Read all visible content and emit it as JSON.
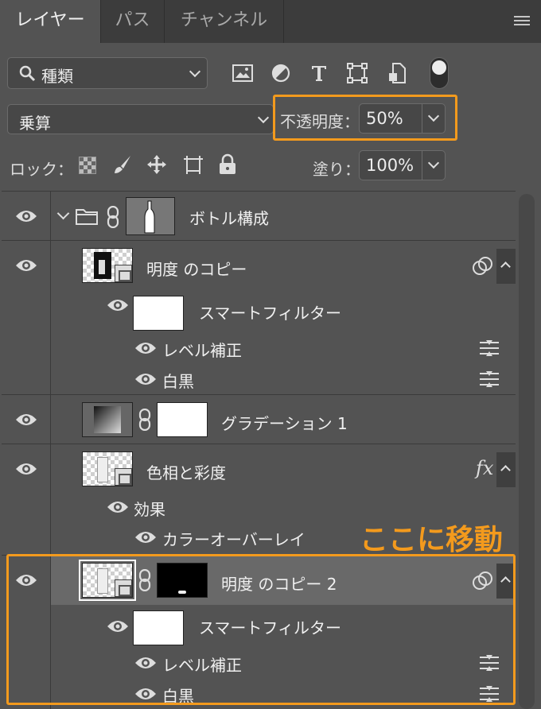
{
  "tabs": [
    "レイヤー",
    "パス",
    "チャンネル"
  ],
  "filter": {
    "kind_label": "種類"
  },
  "blend": {
    "mode": "乗算",
    "opacity_label": "不透明度：",
    "opacity_value": "50%"
  },
  "lock": {
    "label": "ロック：",
    "fill_label": "塗り：",
    "fill_value": "100%"
  },
  "layers": {
    "group_name": "ボトル構成",
    "copy1_name": "明度 のコピー",
    "smart_filter": "スマートフィルター",
    "levels": "レベル補正",
    "bw": "白黒",
    "gradient_name": "グラデーション 1",
    "huesat_name": "色相と彩度",
    "fx_label": "fx",
    "effects": "効果",
    "color_overlay": "カラーオーバーレイ",
    "copy2_name": "明度 のコピー 2",
    "smart_filter_2": "スマートフィルター",
    "levels_2": "レベル補正",
    "bw_2": "白黒"
  },
  "annotation": {
    "text": "ここに移動",
    "color": "#f39a1d"
  },
  "icons": [
    "menu-icon",
    "search-icon",
    "image-filter-icon",
    "adjustment-filter-icon",
    "type-filter-icon",
    "shape-filter-icon",
    "smart-object-filter-icon",
    "filter-toggle",
    "lock-transparent-icon",
    "lock-paint-icon",
    "lock-position-icon",
    "lock-artboard-icon",
    "lock-all-icon",
    "eye-icon",
    "folder-icon",
    "link-icon",
    "filter-options-icon",
    "smart-filter-badge-icon"
  ]
}
